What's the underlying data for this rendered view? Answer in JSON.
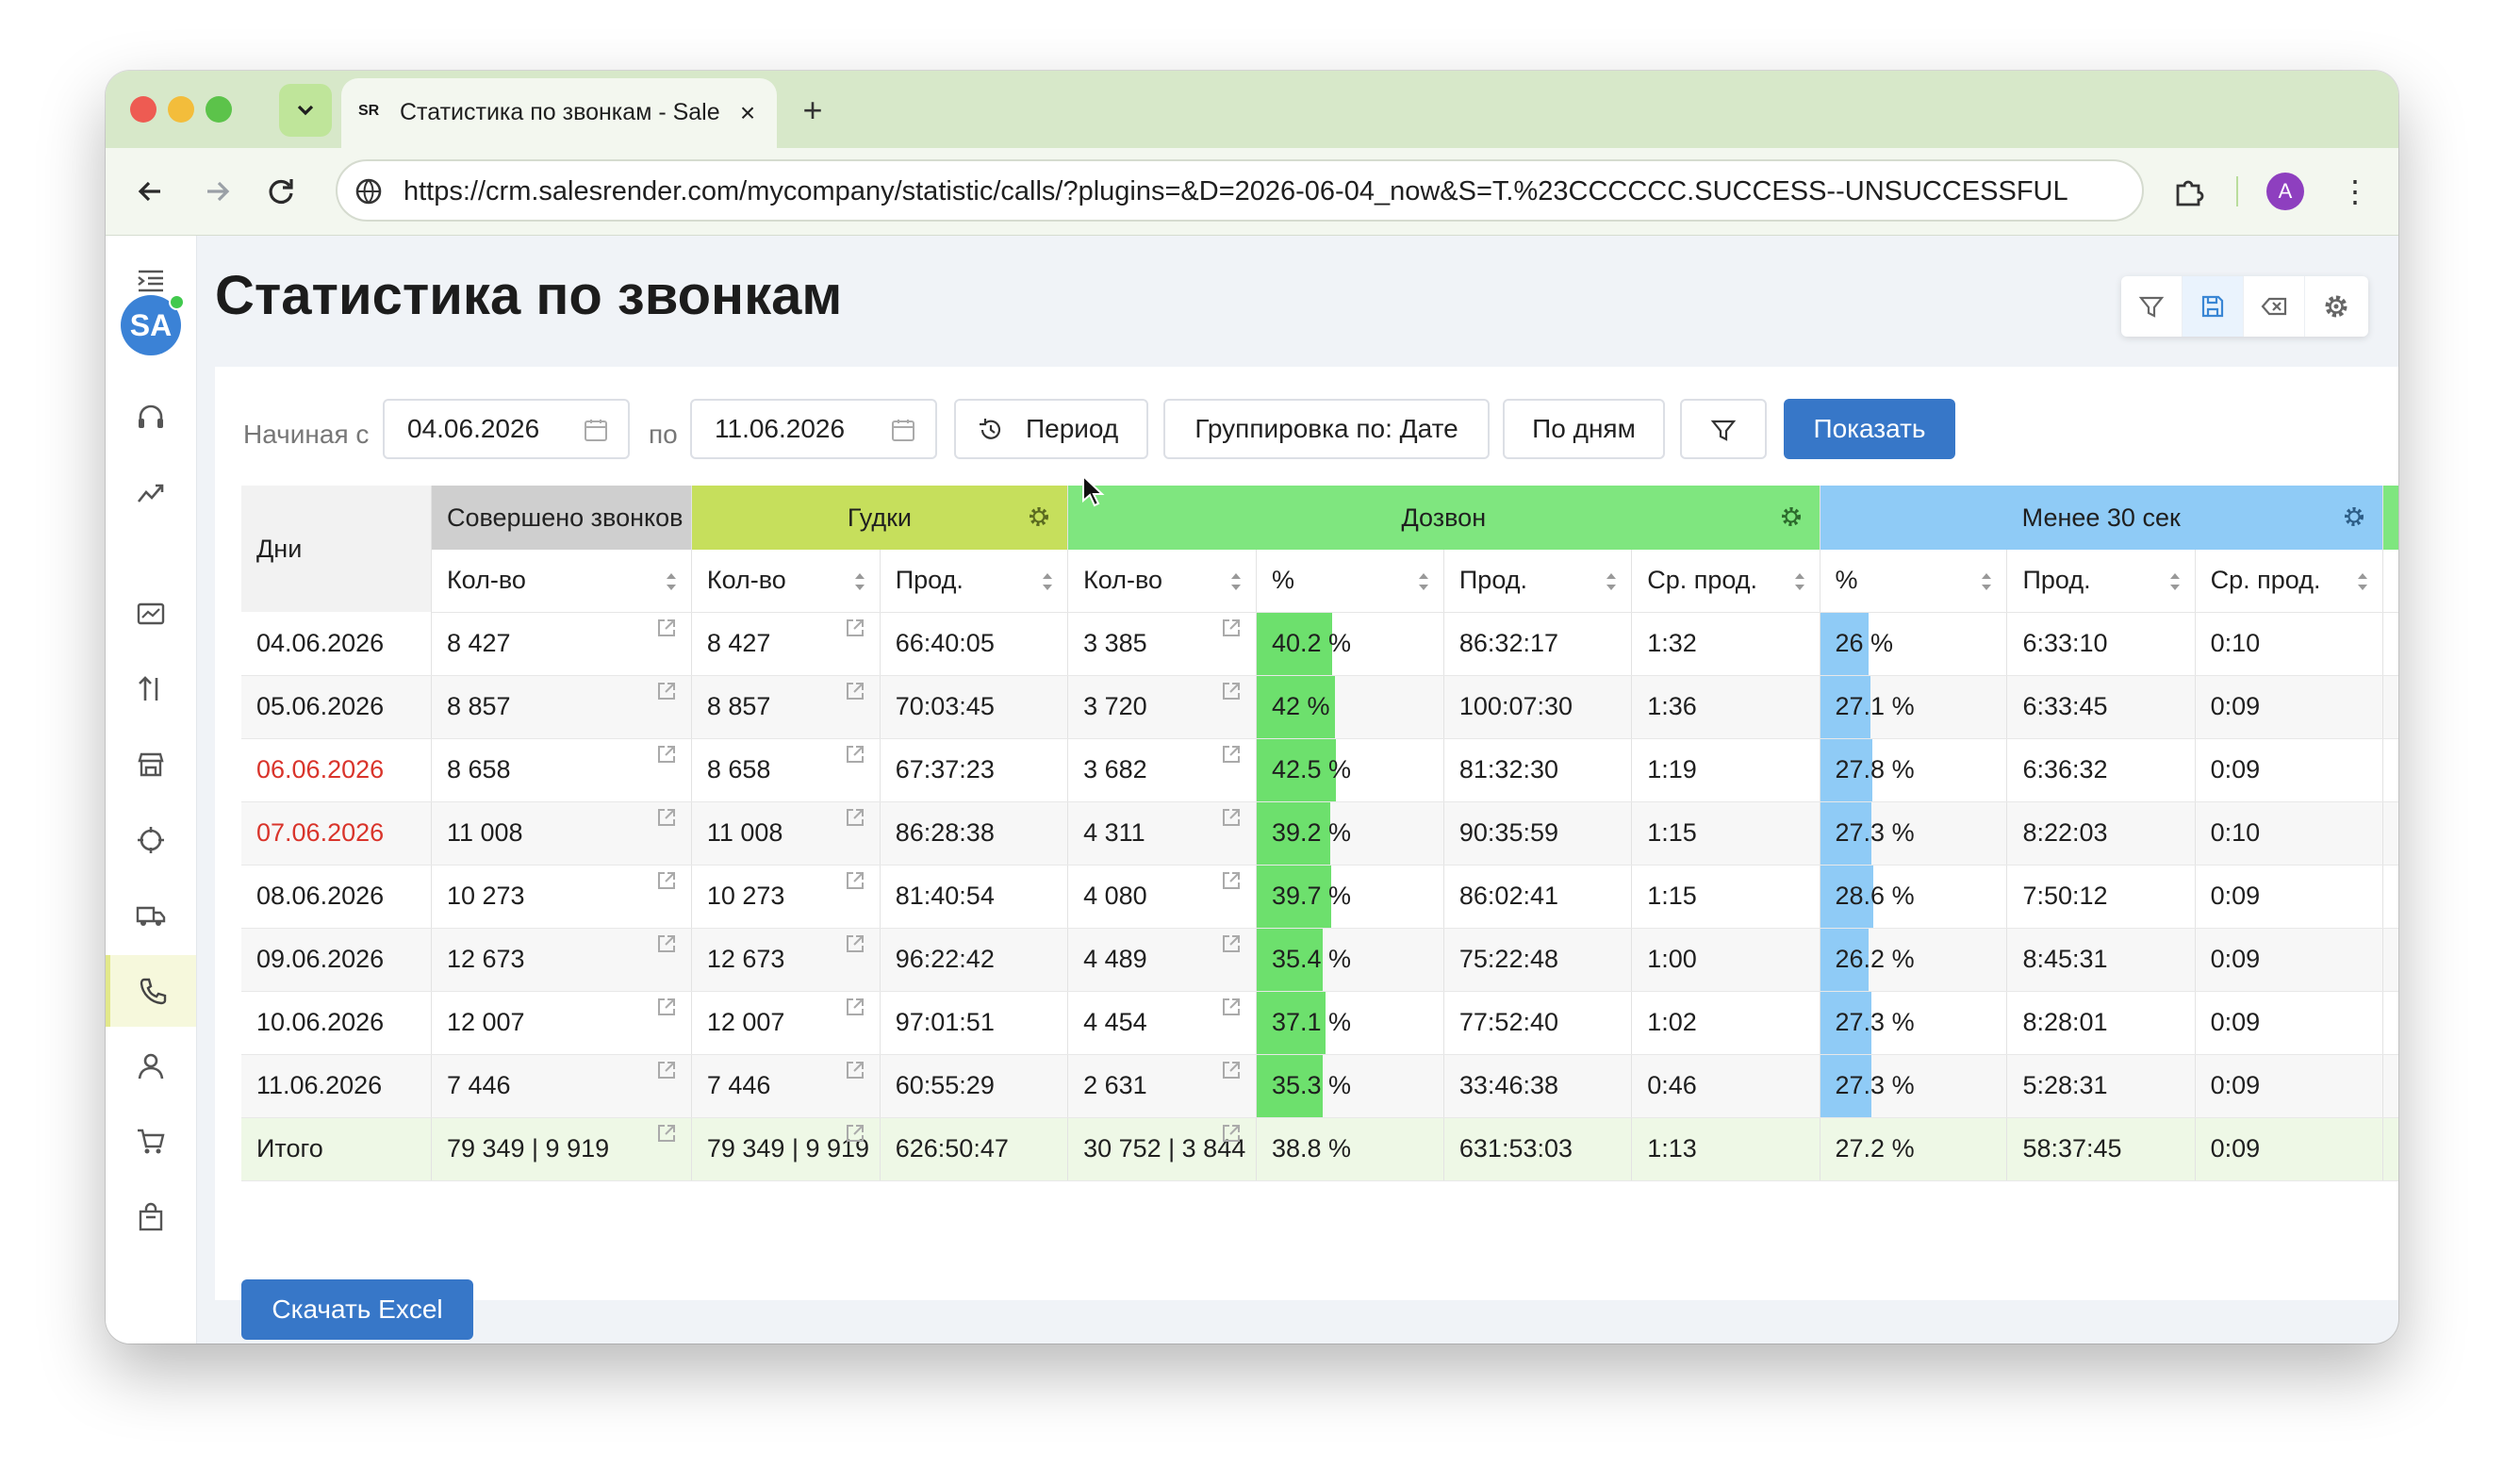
{
  "browser": {
    "tab_favicon": "SR",
    "tab_title": "Статистика по звонкам - SalesRender",
    "url": "https://crm.salesrender.com/mycompany/statistic/calls/?plugins=&D=2026-06-04_now&S=T.%23CCCCCC.SUCCESS--UNSUCCESSFUL",
    "profile_initial": "A"
  },
  "sidebar": {
    "avatar": "SA"
  },
  "page": {
    "title": "Статистика по звонкам"
  },
  "filters": {
    "from_label": "Начиная с",
    "from_value": "04.06.2026",
    "to_label": "по",
    "to_value": "11.06.2026",
    "period_label": "Период",
    "grouping_label": "Группировка по: Дате",
    "by_days_label": "По дням",
    "show_label": "Показать"
  },
  "table": {
    "days_header": "Дни",
    "groups": {
      "calls": "Совершено звонков",
      "beeps": "Гудки",
      "dial": "Дозвон",
      "lt30": "Менее 30 сек"
    },
    "subheaders": {
      "calls_qty": "Кол-во",
      "beeps_qty": "Кол-во",
      "beeps_dur": "Прод.",
      "dial_qty": "Кол-во",
      "dial_pct": "%",
      "dial_dur": "Прод.",
      "dial_avg": "Ср. прод.",
      "lt30_pct": "%",
      "lt30_dur": "Прод.",
      "lt30_avg": "Ср. прод."
    },
    "rows": [
      {
        "day": "04.06.2026",
        "calls": "8 427",
        "beeps": "8 427",
        "beeps_dur": "66:40:05",
        "dial": "3 385",
        "dial_pct": "40.2 %",
        "dial_pct_value": 40.2,
        "dial_dur": "86:32:17",
        "dial_avg": "1:32",
        "lt30_pct": "26 %",
        "lt30_pct_value": 26,
        "lt30_dur": "6:33:10",
        "lt30_avg": "0:10"
      },
      {
        "day": "05.06.2026",
        "calls": "8 857",
        "beeps": "8 857",
        "beeps_dur": "70:03:45",
        "dial": "3 720",
        "dial_pct": "42 %",
        "dial_pct_value": 42,
        "dial_dur": "100:07:30",
        "dial_avg": "1:36",
        "lt30_pct": "27.1 %",
        "lt30_pct_value": 27.1,
        "lt30_dur": "6:33:45",
        "lt30_avg": "0:09"
      },
      {
        "day": "06.06.2026",
        "weekend": true,
        "calls": "8 658",
        "beeps": "8 658",
        "beeps_dur": "67:37:23",
        "dial": "3 682",
        "dial_pct": "42.5 %",
        "dial_pct_value": 42.5,
        "dial_dur": "81:32:30",
        "dial_avg": "1:19",
        "lt30_pct": "27.8 %",
        "lt30_pct_value": 27.8,
        "lt30_dur": "6:36:32",
        "lt30_avg": "0:09"
      },
      {
        "day": "07.06.2026",
        "weekend": true,
        "calls": "11 008",
        "beeps": "11 008",
        "beeps_dur": "86:28:38",
        "dial": "4 311",
        "dial_pct": "39.2 %",
        "dial_pct_value": 39.2,
        "dial_dur": "90:35:59",
        "dial_avg": "1:15",
        "lt30_pct": "27.3 %",
        "lt30_pct_value": 27.3,
        "lt30_dur": "8:22:03",
        "lt30_avg": "0:10"
      },
      {
        "day": "08.06.2026",
        "calls": "10 273",
        "beeps": "10 273",
        "beeps_dur": "81:40:54",
        "dial": "4 080",
        "dial_pct": "39.7 %",
        "dial_pct_value": 39.7,
        "dial_dur": "86:02:41",
        "dial_avg": "1:15",
        "lt30_pct": "28.6 %",
        "lt30_pct_value": 28.6,
        "lt30_dur": "7:50:12",
        "lt30_avg": "0:09"
      },
      {
        "day": "09.06.2026",
        "calls": "12 673",
        "beeps": "12 673",
        "beeps_dur": "96:22:42",
        "dial": "4 489",
        "dial_pct": "35.4 %",
        "dial_pct_value": 35.4,
        "dial_dur": "75:22:48",
        "dial_avg": "1:00",
        "lt30_pct": "26.2 %",
        "lt30_pct_value": 26.2,
        "lt30_dur": "8:45:31",
        "lt30_avg": "0:09"
      },
      {
        "day": "10.06.2026",
        "calls": "12 007",
        "beeps": "12 007",
        "beeps_dur": "97:01:51",
        "dial": "4 454",
        "dial_pct": "37.1 %",
        "dial_pct_value": 37.1,
        "dial_dur": "77:52:40",
        "dial_avg": "1:02",
        "lt30_pct": "27.3 %",
        "lt30_pct_value": 27.3,
        "lt30_dur": "8:28:01",
        "lt30_avg": "0:09"
      },
      {
        "day": "11.06.2026",
        "calls": "7 446",
        "beeps": "7 446",
        "beeps_dur": "60:55:29",
        "dial": "2 631",
        "dial_pct": "35.3 %",
        "dial_pct_value": 35.3,
        "dial_dur": "33:46:38",
        "dial_avg": "0:46",
        "lt30_pct": "27.3 %",
        "lt30_pct_value": 27.3,
        "lt30_dur": "5:28:31",
        "lt30_avg": "0:09"
      }
    ],
    "total": {
      "day": "Итого",
      "calls": "79 349 | 9 919",
      "beeps": "79 349 | 9 919",
      "beeps_dur": "626:50:47",
      "dial": "30 752 | 3 844",
      "dial_pct": "38.8 %",
      "dial_dur": "631:53:03",
      "dial_avg": "1:13",
      "lt30_pct": "27.2 %",
      "lt30_dur": "58:37:45",
      "lt30_avg": "0:09"
    }
  },
  "excel_label": "Скачать Excel",
  "colors": {
    "primary": "#3777c8",
    "beeps": "#c6df5c",
    "dial": "#7fe67f",
    "lt30": "#8fcbf6",
    "weekend": "#d9342b"
  }
}
